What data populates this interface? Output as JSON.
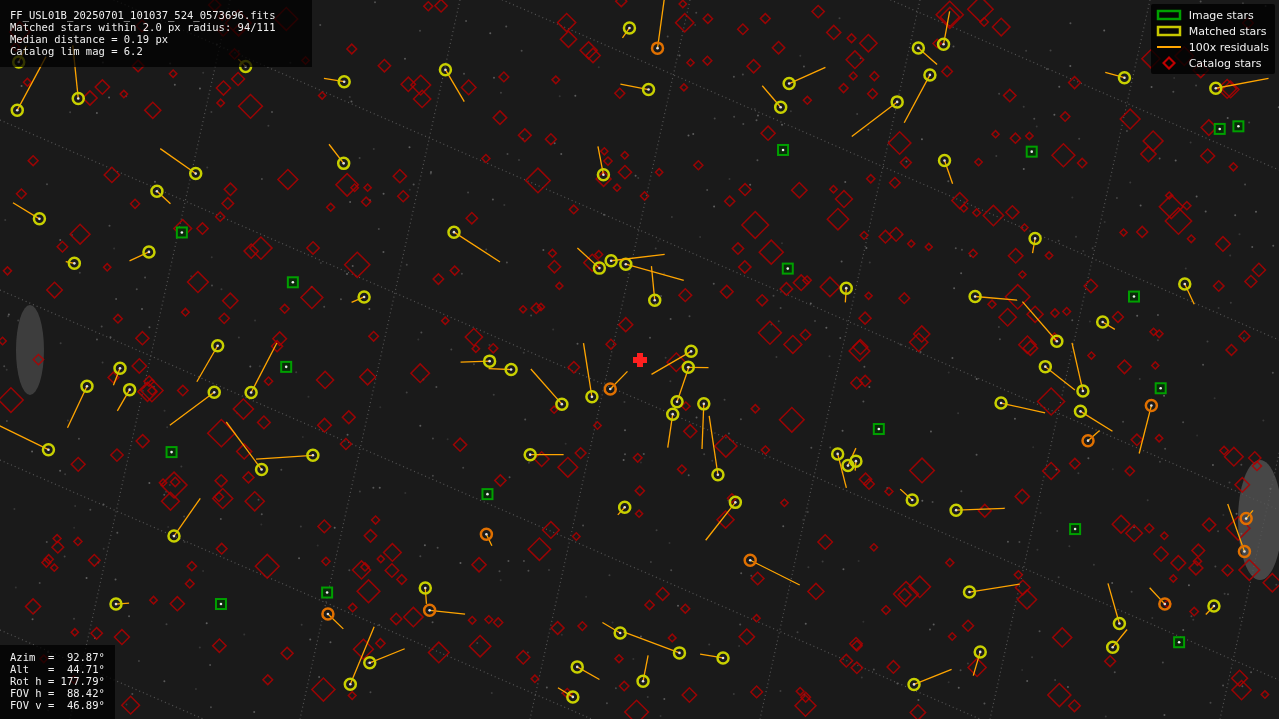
{
  "info": [
    "FF_USL01B_20250701_101037_524_0573696.fits",
    "Matched stars within 2.0 px radius: 94/111",
    "Median distance = 0.19 px",
    "Catalog lim mag = 6.2"
  ],
  "legend": [
    {
      "kind": "image",
      "label": "Image stars",
      "color": "#00a000"
    },
    {
      "kind": "matched",
      "label": "Matched stars",
      "color": "#c8c800"
    },
    {
      "kind": "residual",
      "label": "100x residuals",
      "color": "#ffa500"
    },
    {
      "kind": "catalog",
      "label": "Catalog stars",
      "color": "#c00000"
    }
  ],
  "pointing": [
    "Azim  =  92.87°",
    "Alt   =  44.71°",
    "Rot h = 177.79°",
    "FOV h =  88.42°",
    "FOV v =  46.89°"
  ]
}
